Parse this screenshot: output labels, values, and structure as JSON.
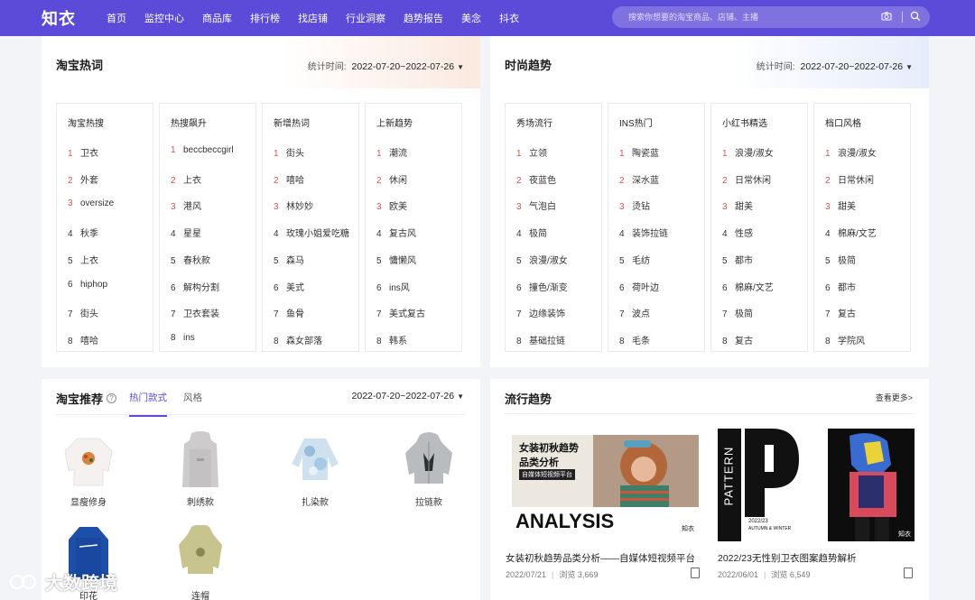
{
  "app": {
    "logo": "知衣"
  },
  "nav": [
    "首页",
    "监控中心",
    "商品库",
    "排行榜",
    "找店铺",
    "行业洞察",
    "趋势报告",
    "美念",
    "抖衣"
  ],
  "search": {
    "placeholder": "搜索你想要的淘宝商品、店铺、主播"
  },
  "icons": {
    "camera": "camera-icon",
    "search": "search-icon"
  },
  "hot_words": {
    "title": "淘宝热词",
    "stat_label": "统计时间:",
    "date_range": "2022-07-20~2022-07-26",
    "columns": [
      {
        "header": "淘宝热搜",
        "items": [
          "卫衣",
          "外套",
          "oversize",
          "秋季",
          "上衣",
          "hiphop",
          "街头",
          "嘻哈"
        ]
      },
      {
        "header": "热搜飙升",
        "items": [
          "beccbeccgirl",
          "上衣",
          "港风",
          "星星",
          "春秋款",
          "解构分割",
          "卫衣套装",
          "ins"
        ]
      },
      {
        "header": "新增热词",
        "items": [
          "街头",
          "嘻哈",
          "林妙妙",
          "玫瑰小姐爱吃糖",
          "森马",
          "美式",
          "鱼骨",
          "森女部落"
        ]
      },
      {
        "header": "上新趋势",
        "items": [
          "潮流",
          "休闲",
          "欧美",
          "复古风",
          "慵懒风",
          "ins风",
          "美式复古",
          "韩系"
        ]
      }
    ]
  },
  "fashion_trend": {
    "title": "时尚趋势",
    "stat_label": "统计时间:",
    "date_range": "2022-07-20~2022-07-26",
    "columns": [
      {
        "header": "秀场流行",
        "items": [
          "立领",
          "夜蓝色",
          "气泡白",
          "极简",
          "浪漫/淑女",
          "撞色/渐变",
          "边缘装饰",
          "基础拉链"
        ]
      },
      {
        "header": "INS热门",
        "items": [
          "陶瓷蓝",
          "深水蓝",
          "烫钻",
          "装饰拉链",
          "毛纺",
          "荷叶边",
          "波点",
          "毛条"
        ]
      },
      {
        "header": "小红书精选",
        "items": [
          "浪漫/淑女",
          "日常休闲",
          "甜美",
          "性感",
          "都市",
          "棉麻/文艺",
          "极简",
          "复古"
        ]
      },
      {
        "header": "档口风格",
        "items": [
          "浪漫/淑女",
          "日常休闲",
          "甜美",
          "棉麻/文艺",
          "极简",
          "都市",
          "复古",
          "学院风"
        ]
      }
    ]
  },
  "recommend": {
    "title": "淘宝推荐",
    "tabs": [
      "热门款式",
      "风格"
    ],
    "date_range": "2022-07-20~2022-07-26",
    "products": [
      "显瘦修身",
      "刺绣款",
      "扎染款",
      "拉链款",
      "印花",
      "连帽"
    ]
  },
  "trends": {
    "title": "流行趋势",
    "more": "查看更多>",
    "cards": [
      {
        "title": "女装初秋趋势品类分析——自媒体短视频平台",
        "date": "2022/07/21",
        "views_label": "浏览",
        "views": "3,669",
        "img_heading": "女装初秋趋势",
        "img_sub": "品类分析",
        "img_tag": "自媒体短视频平台",
        "img_big": "ANALYSIS",
        "img_brand": "知衣"
      },
      {
        "title": "2022/23无性别卫衣图案趋势解析",
        "date": "2022/06/01",
        "views_label": "浏览",
        "views": "6,549",
        "img_vertical": "PATTERN",
        "img_letter": "P",
        "img_year": "2022/23",
        "img_season": "AUTUMN & WINTER",
        "img_brand": "知衣"
      }
    ]
  },
  "watermark": "大数跨境"
}
